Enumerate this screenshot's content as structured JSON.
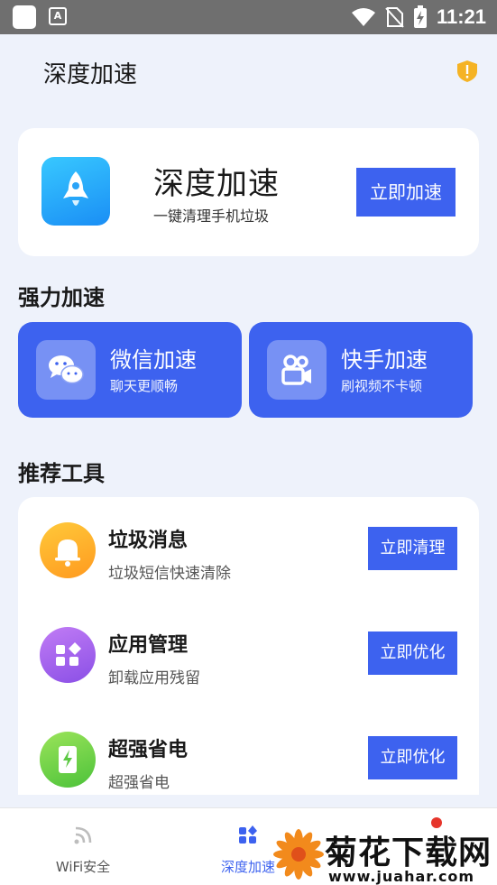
{
  "status_bar": {
    "time": "11:21"
  },
  "header": {
    "title": "深度加速"
  },
  "hero": {
    "title": "深度加速",
    "subtitle": "一键清理手机垃圾",
    "button": "立即加速",
    "icon": "rocket-icon"
  },
  "power_section": {
    "title": "强力加速",
    "cards": [
      {
        "title": "微信加速",
        "subtitle": "聊天更顺畅",
        "icon": "wechat-icon"
      },
      {
        "title": "快手加速",
        "subtitle": "刷视频不卡顿",
        "icon": "kuaishou-icon"
      }
    ]
  },
  "tools_section": {
    "title": "推荐工具",
    "items": [
      {
        "title": "垃圾消息",
        "subtitle": "垃圾短信快速清除",
        "button": "立即清理",
        "icon": "bell-icon"
      },
      {
        "title": "应用管理",
        "subtitle": "卸载应用残留",
        "button": "立即优化",
        "icon": "apps-icon"
      },
      {
        "title": "超强省电",
        "subtitle": "超强省电",
        "button": "立即优化",
        "icon": "battery-icon"
      }
    ]
  },
  "bottom_nav": {
    "items": [
      {
        "label": "WiFi安全",
        "icon": "wifi-icon",
        "active": false
      },
      {
        "label": "深度加速",
        "icon": "grid-icon",
        "active": true
      }
    ]
  },
  "watermark": {
    "title": "菊花下载网",
    "url": "www.juahar.com"
  },
  "colors": {
    "accent": "#3d62ef",
    "background": "#eef2fb",
    "nav_active": "#3d62ef",
    "nav_inactive": "#555555"
  }
}
